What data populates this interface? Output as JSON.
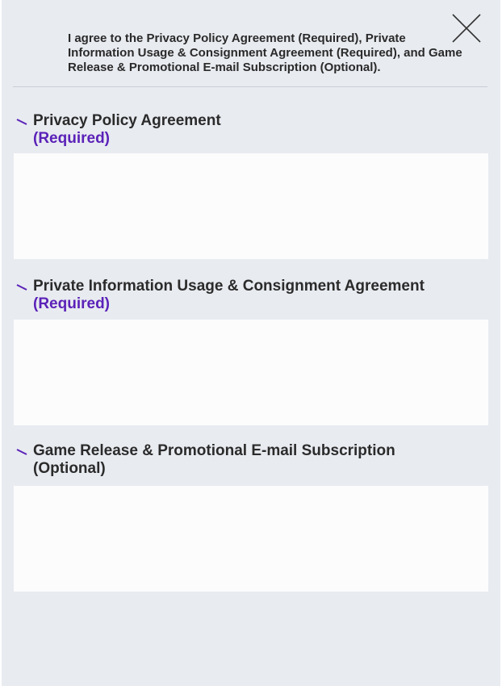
{
  "intro_text": "I agree to the Privacy Policy Agreement (Required), Private Information Usage & Consignment Agreement (Required), and Game Release & Promotional E-mail Subscription (Optional).",
  "close_icon": "close-icon",
  "bullet_icon": "slash-bullet-icon",
  "colors": {
    "accent": "#5b22b8",
    "background": "#e8ebf0",
    "panel": "#fcfcfc"
  },
  "sections": [
    {
      "title": "Privacy Policy Agreement",
      "tag": "(Required)"
    },
    {
      "title": "Private Information Usage & Consignment Agreement",
      "tag": "(Required)"
    },
    {
      "title": "Game Release & Promotional E-mail Subscription",
      "tag": "(Optional)"
    }
  ]
}
